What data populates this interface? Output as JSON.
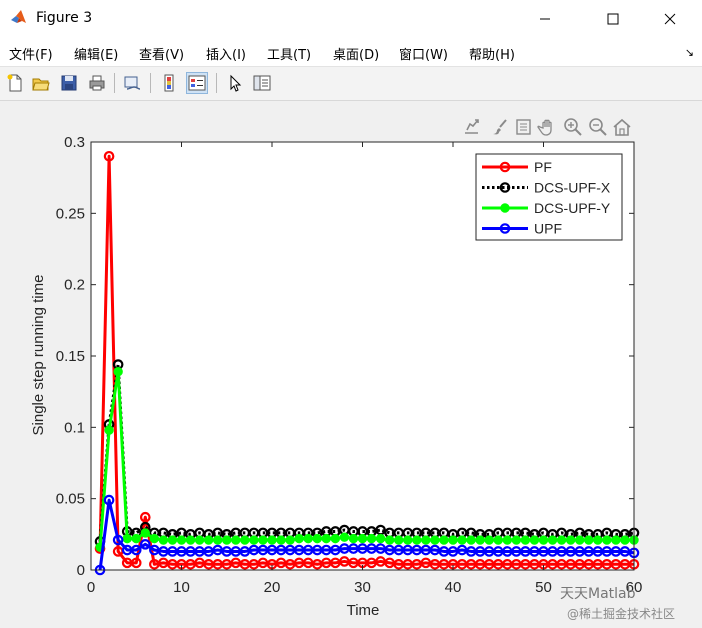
{
  "window": {
    "title": "Figure 3",
    "controls": [
      "minimize",
      "maximize",
      "close"
    ]
  },
  "menubar": {
    "items": [
      {
        "label": "文件(F)"
      },
      {
        "label": "编辑(E)"
      },
      {
        "label": "查看(V)"
      },
      {
        "label": "插入(I)"
      },
      {
        "label": "工具(T)"
      },
      {
        "label": "桌面(D)"
      },
      {
        "label": "窗口(W)"
      },
      {
        "label": "帮助(H)"
      }
    ],
    "overflow_arrow": "↘"
  },
  "toolbar": {
    "buttons": [
      "new-figure-icon",
      "open-file-icon",
      "save-icon",
      "print-icon",
      "link-plot-icon",
      "insert-colorbar-icon",
      "insert-legend-icon",
      "pointer-icon",
      "property-inspector-icon"
    ]
  },
  "axes_toolbar": {
    "buttons": [
      "export-icon",
      "brush-icon",
      "data-tips-icon",
      "pan-icon",
      "zoom-in-icon",
      "zoom-out-icon",
      "home-icon"
    ]
  },
  "chart_data": {
    "type": "line",
    "title": "",
    "xlabel": "Time",
    "ylabel": "Single step running time",
    "xlim": [
      0,
      60
    ],
    "ylim": [
      0,
      0.3
    ],
    "xticks": [
      0,
      10,
      20,
      30,
      40,
      50,
      60
    ],
    "yticks": [
      0,
      0.05,
      0.1,
      0.15,
      0.2,
      0.25,
      0.3
    ],
    "xtick_labels": [
      "0",
      "10",
      "20",
      "30",
      "40",
      "50",
      "60"
    ],
    "ytick_labels": [
      "0",
      "0.05",
      "0.1",
      "0.15",
      "0.2",
      "0.25",
      "0.3"
    ],
    "grid": false,
    "legend_position": "top-right",
    "series": [
      {
        "name": "PF",
        "color": "#ff0000",
        "line_style": "solid",
        "marker": "open-circle",
        "x": [
          1,
          2,
          3,
          4,
          5,
          6,
          7,
          8,
          9,
          10,
          11,
          12,
          13,
          14,
          15,
          16,
          17,
          18,
          19,
          20,
          21,
          22,
          23,
          24,
          25,
          26,
          27,
          28,
          29,
          30,
          31,
          32,
          33,
          34,
          35,
          36,
          37,
          38,
          39,
          40,
          41,
          42,
          43,
          44,
          45,
          46,
          47,
          48,
          49,
          50,
          51,
          52,
          53,
          54,
          55,
          56,
          57,
          58,
          59,
          60
        ],
        "y": [
          0.015,
          0.29,
          0.013,
          0.005,
          0.005,
          0.037,
          0.004,
          0.005,
          0.004,
          0.004,
          0.004,
          0.005,
          0.004,
          0.004,
          0.004,
          0.005,
          0.004,
          0.004,
          0.005,
          0.004,
          0.005,
          0.004,
          0.005,
          0.005,
          0.004,
          0.005,
          0.005,
          0.006,
          0.005,
          0.005,
          0.005,
          0.006,
          0.005,
          0.004,
          0.004,
          0.004,
          0.005,
          0.004,
          0.004,
          0.004,
          0.004,
          0.004,
          0.004,
          0.004,
          0.004,
          0.004,
          0.004,
          0.004,
          0.004,
          0.004,
          0.004,
          0.004,
          0.004,
          0.004,
          0.004,
          0.004,
          0.004,
          0.004,
          0.004,
          0.004
        ]
      },
      {
        "name": "DCS-UPF-X",
        "color": "#000000",
        "line_style": "dotted",
        "marker": "open-circle",
        "x": [
          1,
          2,
          3,
          4,
          5,
          6,
          7,
          8,
          9,
          10,
          11,
          12,
          13,
          14,
          15,
          16,
          17,
          18,
          19,
          20,
          21,
          22,
          23,
          24,
          25,
          26,
          27,
          28,
          29,
          30,
          31,
          32,
          33,
          34,
          35,
          36,
          37,
          38,
          39,
          40,
          41,
          42,
          43,
          44,
          45,
          46,
          47,
          48,
          49,
          50,
          51,
          52,
          53,
          54,
          55,
          56,
          57,
          58,
          59,
          60
        ],
        "y": [
          0.02,
          0.102,
          0.144,
          0.027,
          0.026,
          0.03,
          0.026,
          0.026,
          0.025,
          0.026,
          0.025,
          0.026,
          0.025,
          0.026,
          0.025,
          0.026,
          0.026,
          0.026,
          0.026,
          0.026,
          0.026,
          0.026,
          0.026,
          0.026,
          0.026,
          0.027,
          0.027,
          0.028,
          0.027,
          0.027,
          0.027,
          0.028,
          0.026,
          0.026,
          0.026,
          0.026,
          0.026,
          0.026,
          0.026,
          0.025,
          0.026,
          0.026,
          0.025,
          0.025,
          0.026,
          0.026,
          0.026,
          0.026,
          0.025,
          0.026,
          0.025,
          0.026,
          0.025,
          0.026,
          0.025,
          0.025,
          0.026,
          0.025,
          0.025,
          0.026
        ]
      },
      {
        "name": "DCS-UPF-Y",
        "color": "#00ff00",
        "line_style": "solid",
        "marker": "filled-circle",
        "x": [
          1,
          2,
          3,
          4,
          5,
          6,
          7,
          8,
          9,
          10,
          11,
          12,
          13,
          14,
          15,
          16,
          17,
          18,
          19,
          20,
          21,
          22,
          23,
          24,
          25,
          26,
          27,
          28,
          29,
          30,
          31,
          32,
          33,
          34,
          35,
          36,
          37,
          38,
          39,
          40,
          41,
          42,
          43,
          44,
          45,
          46,
          47,
          48,
          49,
          50,
          51,
          52,
          53,
          54,
          55,
          56,
          57,
          58,
          59,
          60
        ],
        "y": [
          0.016,
          0.098,
          0.139,
          0.022,
          0.022,
          0.026,
          0.022,
          0.021,
          0.021,
          0.021,
          0.021,
          0.021,
          0.021,
          0.021,
          0.021,
          0.021,
          0.021,
          0.021,
          0.021,
          0.021,
          0.021,
          0.021,
          0.022,
          0.022,
          0.022,
          0.022,
          0.022,
          0.023,
          0.022,
          0.022,
          0.022,
          0.022,
          0.021,
          0.021,
          0.021,
          0.021,
          0.021,
          0.021,
          0.021,
          0.021,
          0.021,
          0.021,
          0.021,
          0.021,
          0.021,
          0.021,
          0.021,
          0.021,
          0.021,
          0.021,
          0.021,
          0.021,
          0.021,
          0.021,
          0.021,
          0.021,
          0.021,
          0.021,
          0.021,
          0.021
        ]
      },
      {
        "name": "UPF",
        "color": "#0000ff",
        "line_style": "solid",
        "marker": "open-circle",
        "x": [
          1,
          2,
          3,
          4,
          5,
          6,
          7,
          8,
          9,
          10,
          11,
          12,
          13,
          14,
          15,
          16,
          17,
          18,
          19,
          20,
          21,
          22,
          23,
          24,
          25,
          26,
          27,
          28,
          29,
          30,
          31,
          32,
          33,
          34,
          35,
          36,
          37,
          38,
          39,
          40,
          41,
          42,
          43,
          44,
          45,
          46,
          47,
          48,
          49,
          50,
          51,
          52,
          53,
          54,
          55,
          56,
          57,
          58,
          59,
          60
        ],
        "y": [
          0.0,
          0.049,
          0.021,
          0.014,
          0.014,
          0.018,
          0.014,
          0.013,
          0.013,
          0.013,
          0.013,
          0.013,
          0.013,
          0.014,
          0.013,
          0.013,
          0.013,
          0.014,
          0.014,
          0.014,
          0.014,
          0.014,
          0.014,
          0.014,
          0.014,
          0.014,
          0.014,
          0.015,
          0.015,
          0.015,
          0.015,
          0.015,
          0.014,
          0.014,
          0.014,
          0.014,
          0.014,
          0.014,
          0.013,
          0.013,
          0.014,
          0.013,
          0.013,
          0.013,
          0.013,
          0.013,
          0.013,
          0.013,
          0.013,
          0.013,
          0.013,
          0.013,
          0.013,
          0.013,
          0.013,
          0.013,
          0.013,
          0.013,
          0.013,
          0.012
        ]
      }
    ]
  },
  "watermark": {
    "line1": "天天Matlab",
    "line2": "@稀土掘金技术社区"
  }
}
